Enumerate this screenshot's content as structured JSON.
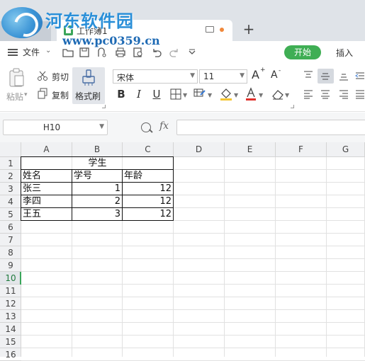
{
  "watermark": {
    "title": "河东软件园",
    "url": "www.pc0359.cn"
  },
  "tabs": {
    "active_label": "工作簿1",
    "new_tab": "+"
  },
  "menu": {
    "file": "文件",
    "start": "开始",
    "insert": "插入"
  },
  "ribbon": {
    "paste": "粘贴",
    "cut": "剪切",
    "copy": "复制",
    "format_painter": "格式刷",
    "font_name": "宋体",
    "font_size": "11",
    "bold": "B",
    "italic": "I",
    "underline": "U",
    "grow_font": "A",
    "shrink_font": "A"
  },
  "formula_bar": {
    "name_box": "H10",
    "fx": "fx",
    "formula": ""
  },
  "colors": {
    "accent_green": "#3fae54",
    "active_row": "#1f7a3c",
    "font_color_bar": "#e0302b",
    "fill_color_bar": "#f4c430"
  },
  "sheet": {
    "columns": [
      "A",
      "B",
      "C",
      "D",
      "E",
      "F",
      "G"
    ],
    "rows": [
      "1",
      "2",
      "3",
      "4",
      "5",
      "6",
      "7",
      "8",
      "9",
      "10",
      "11",
      "12",
      "13",
      "14",
      "15",
      "16"
    ],
    "active_row": "10",
    "title_cell": "学生",
    "headers": [
      "姓名",
      "学号",
      "年龄"
    ],
    "records": [
      {
        "name": "张三",
        "id": "1",
        "age": "12"
      },
      {
        "name": "李四",
        "id": "2",
        "age": "12"
      },
      {
        "name": "王五",
        "id": "3",
        "age": "12"
      }
    ]
  }
}
